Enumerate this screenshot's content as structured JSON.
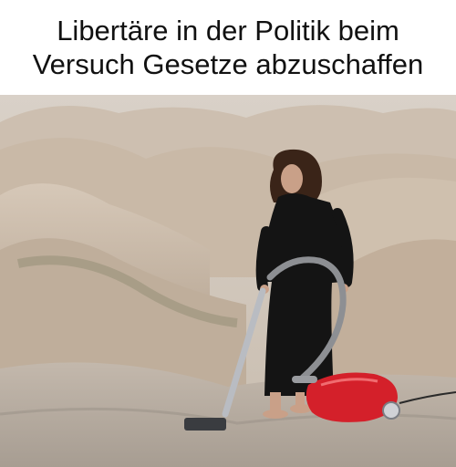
{
  "caption": {
    "line1": "Libertäre in der Politik beim",
    "line2": "Versuch Gesetze abzuschaffen"
  },
  "photo": {
    "subject": "woman in black dress vacuuming in desert hills",
    "colors": {
      "sky_haze": "#cfc6bc",
      "hills_light": "#d8cabb",
      "hills_shadow": "#a89886",
      "ground": "#b8b0a6",
      "dress": "#141414",
      "hair": "#3a2418",
      "skin": "#c9a088",
      "vacuum_body": "#d4202a",
      "vacuum_hose": "#8d8f93",
      "vacuum_wand": "#b9bcc2"
    }
  }
}
